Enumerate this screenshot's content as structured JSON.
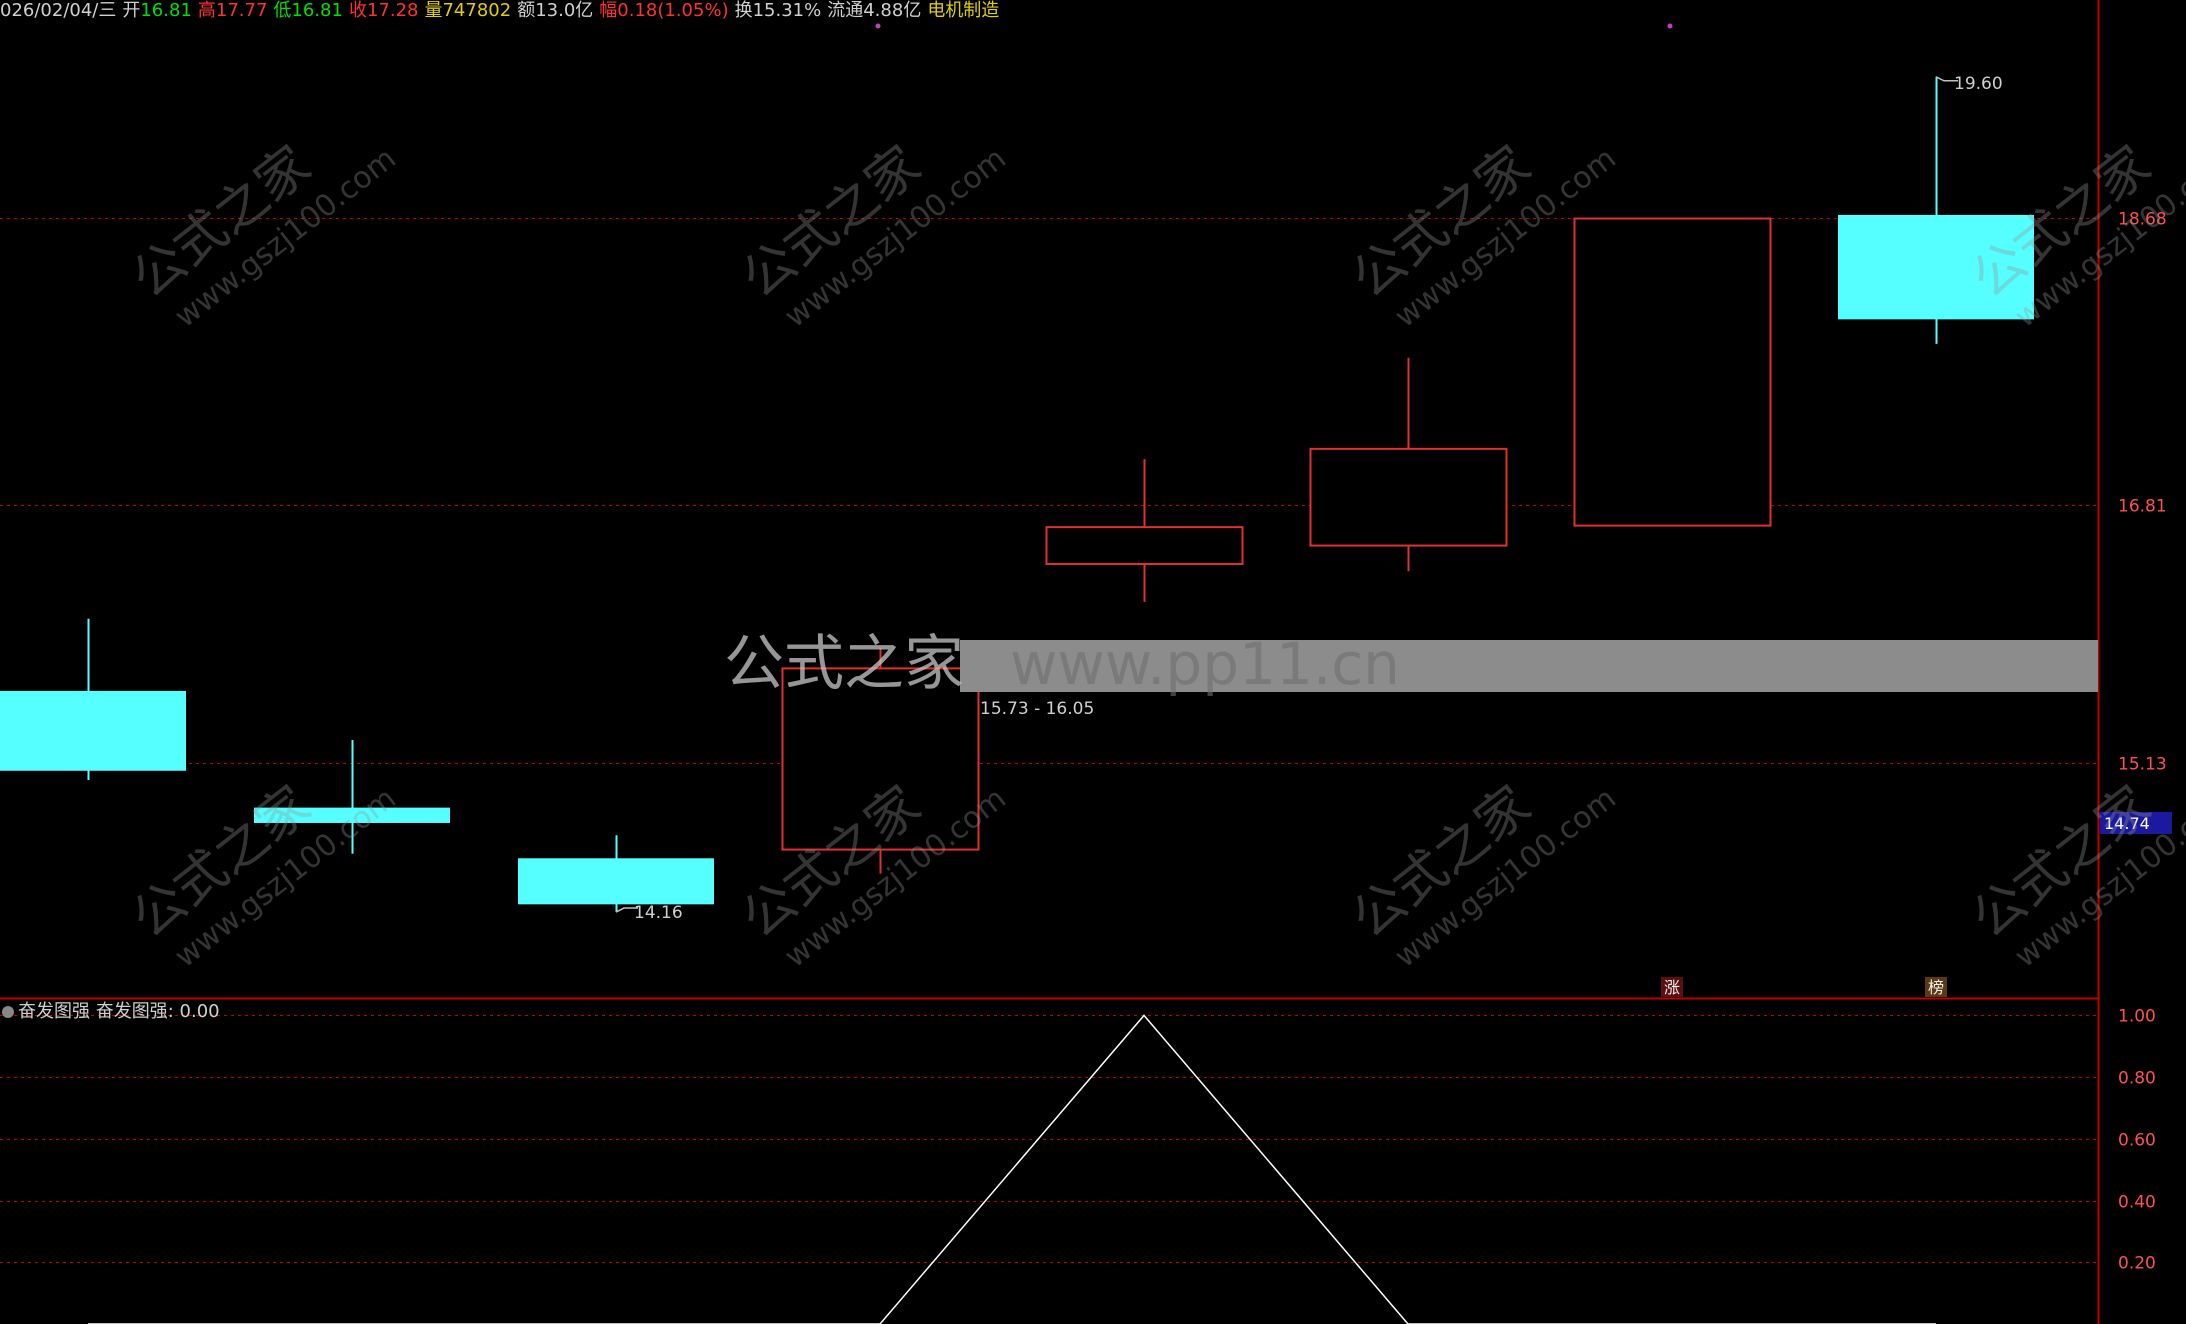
{
  "header": {
    "date": "026/02/04/三",
    "open_label": "开",
    "open": "16.81",
    "high_label": "高",
    "high": "17.77",
    "low_label": "低",
    "low": "16.81",
    "close_label": "收",
    "close": "17.28",
    "volume_label": "量",
    "volume": "747802",
    "amount_label": "额",
    "amount": "13.0亿",
    "change_label": "幅",
    "change": "0.18(1.05%)",
    "turnover_label": "换",
    "turnover": "15.31%",
    "float_label": "流通",
    "float_value": "4.88亿",
    "sector": "电机制造"
  },
  "indicator": {
    "name": "奋发图强",
    "readout_label": "奋发图强:",
    "readout_value": "0.00"
  },
  "colors": {
    "up": "#e03030",
    "down": "#55ffff",
    "grid": "#c00000",
    "axis_text": "#ff5050",
    "line": "#ffffff",
    "overlay_band": "#8c8c8c"
  },
  "chart_data": [
    {
      "type": "candlestick",
      "ylim": [
        13.6,
        20.1
      ],
      "y_ticks": [
        {
          "value": 18.68,
          "label": "18.68"
        },
        {
          "value": 16.81,
          "label": "16.81"
        },
        {
          "value": 15.13,
          "label": "15.13"
        }
      ],
      "grid": true,
      "candles": [
        {
          "open": 15.6,
          "high": 16.07,
          "low": 15.02,
          "close": 15.08
        },
        {
          "open": 14.84,
          "high": 15.28,
          "low": 14.54,
          "close": 14.74
        },
        {
          "open": 14.51,
          "high": 14.66,
          "low": 14.16,
          "close": 14.21
        },
        {
          "open": 14.57,
          "high": 15.88,
          "low": 14.41,
          "close": 15.75
        },
        {
          "open": 16.43,
          "high": 17.11,
          "low": 16.18,
          "close": 16.67
        },
        {
          "open": 16.55,
          "high": 17.77,
          "low": 16.38,
          "close": 17.18
        },
        {
          "open": 16.68,
          "high": 18.68,
          "low": 16.68,
          "close": 18.68
        },
        {
          "open": 18.7,
          "high": 19.6,
          "low": 17.86,
          "close": 18.02
        }
      ],
      "price_annotations": [
        {
          "candle": 2,
          "text": "14.16"
        },
        {
          "candle": 7,
          "text": "19.60"
        }
      ],
      "range_label": "15.73 - 16.05",
      "current_price_tag": "14.74",
      "markers": [
        {
          "candle": 6,
          "text": "涨"
        },
        {
          "candle": 7,
          "text": "榜"
        }
      ]
    },
    {
      "type": "line",
      "title": "奋发图强",
      "ylim": [
        0,
        1.05
      ],
      "y_ticks": [
        1.0,
        0.8,
        0.6,
        0.4,
        0.2
      ],
      "y_tick_labels": [
        "1.00",
        "0.80",
        "0.60",
        "0.40",
        "0.20"
      ],
      "values": [
        0,
        0,
        0,
        0,
        1,
        0,
        0,
        0
      ]
    }
  ],
  "watermarks": {
    "cn": "公式之家",
    "url": "www.gszj100.com",
    "band_cn": "公式之家",
    "band_url": "www.pp11.cn"
  }
}
